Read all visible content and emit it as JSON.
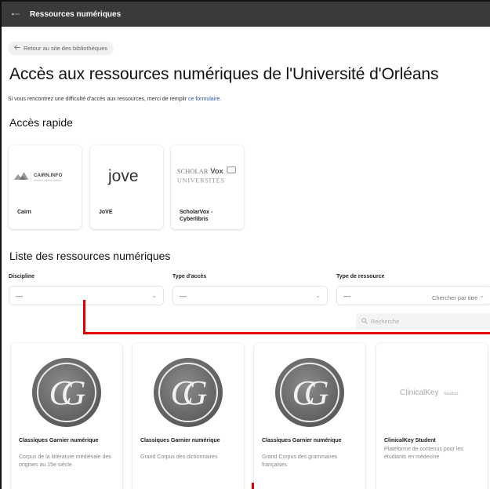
{
  "app": {
    "title": "Ressources numériques"
  },
  "nav": {
    "back_label": "Retour au site des bibliothèques"
  },
  "page": {
    "title": "Accès aux ressources numériques de l'Université d'Orléans",
    "intro_text": "Si vous rencontrez une difficulté d'accès aux ressources, merci de remplir ",
    "intro_link": "ce formulaire",
    "intro_end": "."
  },
  "quick_access": {
    "heading": "Accès rapide",
    "items": [
      {
        "name": "Cairn",
        "logo_text": "CAIRN.INFO",
        "logo_sub": "chercher, repérer, avancer",
        "icon": "cairn-logo"
      },
      {
        "name": "JoVE",
        "logo_text": "jove",
        "icon": "jove-logo"
      },
      {
        "name": "ScholarVox - Cyberlibris",
        "logo_text_1": "SCHOLAR",
        "logo_text_2": "Vox",
        "logo_text_3": "UNIVERSITÉS",
        "icon": "scholarvox-logo"
      }
    ]
  },
  "resources": {
    "heading": "Liste des ressources numériques",
    "filters": [
      {
        "label": "Discipline",
        "value": "—"
      },
      {
        "label": "Type d'accès",
        "value": "—"
      },
      {
        "label": "Type de ressource",
        "value": "—"
      }
    ],
    "search_label": "Chercher par titre",
    "search_placeholder": "Recherche",
    "items": [
      {
        "name": "Classiques Garnier numérique",
        "description": "Corpus de la littérature médiévale des origines au 15e siècle",
        "icon": "classiques-garnier-logo"
      },
      {
        "name": "Classiques Garnier numérique",
        "description": "Grand Corpus des dictionnaires",
        "icon": "classiques-garnier-logo"
      },
      {
        "name": "Classiques Garnier numérique",
        "description": "Grand Corpus des grammaires françaises",
        "icon": "classiques-garnier-logo"
      },
      {
        "name": "ClinicalKey Student",
        "description": "Plateforme de contenus pour les étudiants en médecine",
        "logo_text": "ClinicalKey",
        "logo_sub": "Student",
        "icon": "clinicalkey-logo"
      }
    ]
  },
  "colors": {
    "topbar": "#3a3a3a",
    "link": "#2a58a8",
    "annotation": "#e00000"
  }
}
